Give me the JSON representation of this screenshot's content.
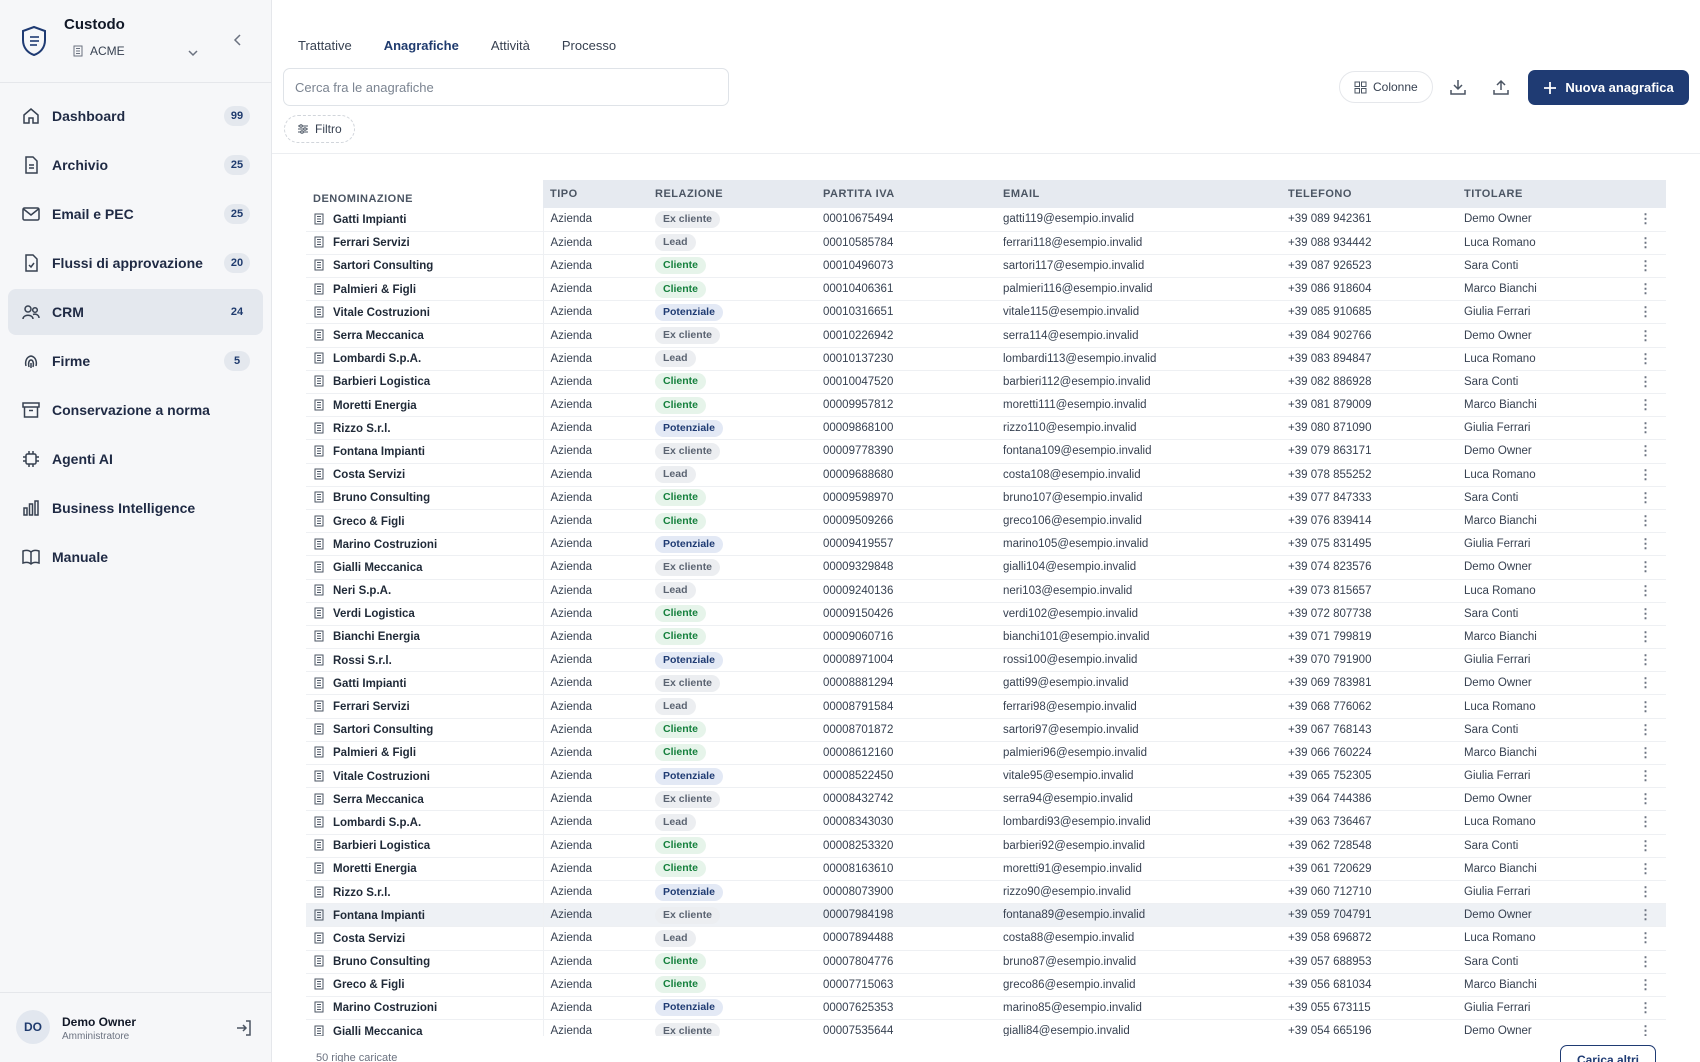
{
  "brand": {
    "name": "Custodo",
    "org": "ACME"
  },
  "sidebar": {
    "items": [
      {
        "label": "Dashboard",
        "badge": "99",
        "icon": "home-icon"
      },
      {
        "label": "Archivio",
        "badge": "25",
        "icon": "document-icon"
      },
      {
        "label": "Email e PEC",
        "badge": "25",
        "icon": "mail-icon"
      },
      {
        "label": "Flussi di approvazione",
        "badge": "20",
        "icon": "approval-icon"
      },
      {
        "label": "CRM",
        "badge": "24",
        "icon": "users-icon",
        "active": true
      },
      {
        "label": "Firme",
        "badge": "5",
        "icon": "fingerprint-icon"
      },
      {
        "label": "Conservazione a norma",
        "badge": "",
        "icon": "archive-box-icon"
      },
      {
        "label": "Agenti AI",
        "badge": "",
        "icon": "chip-icon"
      },
      {
        "label": "Business Intelligence",
        "badge": "",
        "icon": "bar-chart-icon"
      },
      {
        "label": "Manuale",
        "badge": "",
        "icon": "book-icon"
      }
    ]
  },
  "user": {
    "initials": "DO",
    "name": "Demo Owner",
    "role": "Amministratore"
  },
  "tabs": [
    {
      "label": "Trattative"
    },
    {
      "label": "Anagrafiche",
      "active": true
    },
    {
      "label": "Attività"
    },
    {
      "label": "Processo"
    }
  ],
  "toolbar": {
    "search_placeholder": "Cerca fra le anagrafiche",
    "filter_label": "Filtro",
    "columns_label": "Colonne",
    "new_label": "Nuova anagrafica"
  },
  "table": {
    "headers": [
      "DENOMINAZIONE",
      "TIPO",
      "RELAZIONE",
      "PARTITA IVA",
      "EMAIL",
      "TELEFONO",
      "TITOLARE"
    ],
    "rows": [
      [
        "Gatti Impianti",
        "Azienda",
        "Ex cliente",
        "00010675494",
        "gatti119@esempio.invalid",
        "+39 089 942361",
        "Demo Owner"
      ],
      [
        "Ferrari Servizi",
        "Azienda",
        "Lead",
        "00010585784",
        "ferrari118@esempio.invalid",
        "+39 088 934442",
        "Luca Romano"
      ],
      [
        "Sartori Consulting",
        "Azienda",
        "Cliente",
        "00010496073",
        "sartori117@esempio.invalid",
        "+39 087 926523",
        "Sara Conti"
      ],
      [
        "Palmieri & Figli",
        "Azienda",
        "Cliente",
        "00010406361",
        "palmieri116@esempio.invalid",
        "+39 086 918604",
        "Marco Bianchi"
      ],
      [
        "Vitale Costruzioni",
        "Azienda",
        "Potenziale",
        "00010316651",
        "vitale115@esempio.invalid",
        "+39 085 910685",
        "Giulia Ferrari"
      ],
      [
        "Serra Meccanica",
        "Azienda",
        "Ex cliente",
        "00010226942",
        "serra114@esempio.invalid",
        "+39 084 902766",
        "Demo Owner"
      ],
      [
        "Lombardi S.p.A.",
        "Azienda",
        "Lead",
        "00010137230",
        "lombardi113@esempio.invalid",
        "+39 083 894847",
        "Luca Romano"
      ],
      [
        "Barbieri Logistica",
        "Azienda",
        "Cliente",
        "00010047520",
        "barbieri112@esempio.invalid",
        "+39 082 886928",
        "Sara Conti"
      ],
      [
        "Moretti Energia",
        "Azienda",
        "Cliente",
        "00009957812",
        "moretti111@esempio.invalid",
        "+39 081 879009",
        "Marco Bianchi"
      ],
      [
        "Rizzo S.r.l.",
        "Azienda",
        "Potenziale",
        "00009868100",
        "rizzo110@esempio.invalid",
        "+39 080 871090",
        "Giulia Ferrari"
      ],
      [
        "Fontana Impianti",
        "Azienda",
        "Ex cliente",
        "00009778390",
        "fontana109@esempio.invalid",
        "+39 079 863171",
        "Demo Owner"
      ],
      [
        "Costa Servizi",
        "Azienda",
        "Lead",
        "00009688680",
        "costa108@esempio.invalid",
        "+39 078 855252",
        "Luca Romano"
      ],
      [
        "Bruno Consulting",
        "Azienda",
        "Cliente",
        "00009598970",
        "bruno107@esempio.invalid",
        "+39 077 847333",
        "Sara Conti"
      ],
      [
        "Greco & Figli",
        "Azienda",
        "Cliente",
        "00009509266",
        "greco106@esempio.invalid",
        "+39 076 839414",
        "Marco Bianchi"
      ],
      [
        "Marino Costruzioni",
        "Azienda",
        "Potenziale",
        "00009419557",
        "marino105@esempio.invalid",
        "+39 075 831495",
        "Giulia Ferrari"
      ],
      [
        "Gialli Meccanica",
        "Azienda",
        "Ex cliente",
        "00009329848",
        "gialli104@esempio.invalid",
        "+39 074 823576",
        "Demo Owner"
      ],
      [
        "Neri S.p.A.",
        "Azienda",
        "Lead",
        "00009240136",
        "neri103@esempio.invalid",
        "+39 073 815657",
        "Luca Romano"
      ],
      [
        "Verdi Logistica",
        "Azienda",
        "Cliente",
        "00009150426",
        "verdi102@esempio.invalid",
        "+39 072 807738",
        "Sara Conti"
      ],
      [
        "Bianchi Energia",
        "Azienda",
        "Cliente",
        "00009060716",
        "bianchi101@esempio.invalid",
        "+39 071 799819",
        "Marco Bianchi"
      ],
      [
        "Rossi S.r.l.",
        "Azienda",
        "Potenziale",
        "00008971004",
        "rossi100@esempio.invalid",
        "+39 070 791900",
        "Giulia Ferrari"
      ],
      [
        "Gatti Impianti",
        "Azienda",
        "Ex cliente",
        "00008881294",
        "gatti99@esempio.invalid",
        "+39 069 783981",
        "Demo Owner"
      ],
      [
        "Ferrari Servizi",
        "Azienda",
        "Lead",
        "00008791584",
        "ferrari98@esempio.invalid",
        "+39 068 776062",
        "Luca Romano"
      ],
      [
        "Sartori Consulting",
        "Azienda",
        "Cliente",
        "00008701872",
        "sartori97@esempio.invalid",
        "+39 067 768143",
        "Sara Conti"
      ],
      [
        "Palmieri & Figli",
        "Azienda",
        "Cliente",
        "00008612160",
        "palmieri96@esempio.invalid",
        "+39 066 760224",
        "Marco Bianchi"
      ],
      [
        "Vitale Costruzioni",
        "Azienda",
        "Potenziale",
        "00008522450",
        "vitale95@esempio.invalid",
        "+39 065 752305",
        "Giulia Ferrari"
      ],
      [
        "Serra Meccanica",
        "Azienda",
        "Ex cliente",
        "00008432742",
        "serra94@esempio.invalid",
        "+39 064 744386",
        "Demo Owner"
      ],
      [
        "Lombardi S.p.A.",
        "Azienda",
        "Lead",
        "00008343030",
        "lombardi93@esempio.invalid",
        "+39 063 736467",
        "Luca Romano"
      ],
      [
        "Barbieri Logistica",
        "Azienda",
        "Cliente",
        "00008253320",
        "barbieri92@esempio.invalid",
        "+39 062 728548",
        "Sara Conti"
      ],
      [
        "Moretti Energia",
        "Azienda",
        "Cliente",
        "00008163610",
        "moretti91@esempio.invalid",
        "+39 061 720629",
        "Marco Bianchi"
      ],
      [
        "Rizzo S.r.l.",
        "Azienda",
        "Potenziale",
        "00008073900",
        "rizzo90@esempio.invalid",
        "+39 060 712710",
        "Giulia Ferrari"
      ],
      [
        "Fontana Impianti",
        "Azienda",
        "Ex cliente",
        "00007984198",
        "fontana89@esempio.invalid",
        "+39 059 704791",
        "Demo Owner"
      ],
      [
        "Costa Servizi",
        "Azienda",
        "Lead",
        "00007894488",
        "costa88@esempio.invalid",
        "+39 058 696872",
        "Luca Romano"
      ],
      [
        "Bruno Consulting",
        "Azienda",
        "Cliente",
        "00007804776",
        "bruno87@esempio.invalid",
        "+39 057 688953",
        "Sara Conti"
      ],
      [
        "Greco & Figli",
        "Azienda",
        "Cliente",
        "00007715063",
        "greco86@esempio.invalid",
        "+39 056 681034",
        "Marco Bianchi"
      ],
      [
        "Marino Costruzioni",
        "Azienda",
        "Potenziale",
        "00007625353",
        "marino85@esempio.invalid",
        "+39 055 673115",
        "Giulia Ferrari"
      ],
      [
        "Gialli Meccanica",
        "Azienda",
        "Ex cliente",
        "00007535644",
        "gialli84@esempio.invalid",
        "+39 054 665196",
        "Demo Owner"
      ]
    ],
    "highlighted_row": 30
  },
  "footer": {
    "count_text": "50 righe caricate",
    "load_more_label": "Carica altri"
  }
}
